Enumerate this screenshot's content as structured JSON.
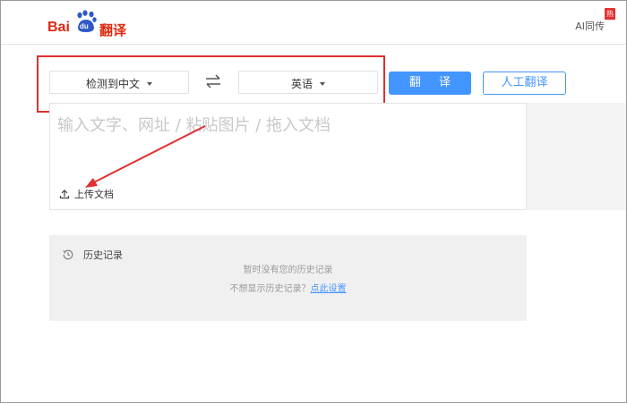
{
  "header": {
    "logo": {
      "bai": "Bai",
      "du": "du",
      "fanyi": "翻译"
    },
    "ai_sync_label": "AI同传",
    "hot_badge": "热"
  },
  "toolbar": {
    "source_language": "检测到中文",
    "target_language": "英语",
    "translate_label": "翻 译",
    "human_translate_label": "人工翻译"
  },
  "input": {
    "placeholder": "输入文字、网址 / 粘贴图片 / 拖入文档",
    "upload_label": "上传文档"
  },
  "history": {
    "title": "历史记录",
    "empty_text": "暂时没有您的历史记录",
    "hint_text": "不想显示历史记录？",
    "hint_link": "点此设置"
  },
  "colors": {
    "brand_red": "#de2910",
    "accent_blue": "#4395ff",
    "annotation_red": "#e03030"
  }
}
